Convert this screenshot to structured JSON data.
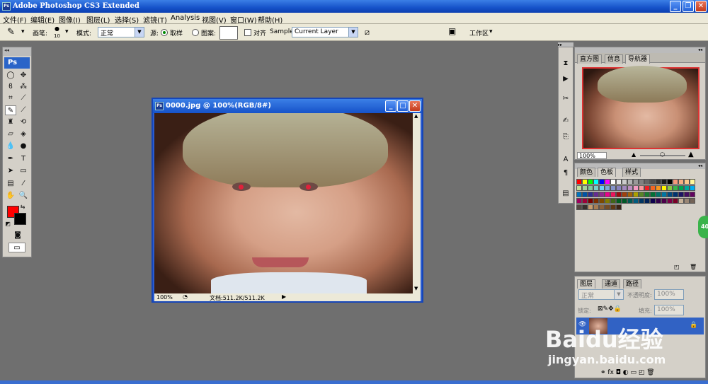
{
  "titlebar": {
    "title": "Adobe Photoshop CS3 Extended"
  },
  "menu": {
    "items": [
      "文件(F)",
      "编辑(E)",
      "图像(I)",
      "图层(L)",
      "选择(S)",
      "滤镜(T)",
      "Analysis",
      "视图(V)",
      "窗口(W)",
      "帮助(H)"
    ]
  },
  "options": {
    "brush_label": "画笔:",
    "brush_size": "10",
    "mode_label": "模式:",
    "mode_value": "正常",
    "source_label": "源:",
    "sampled_label": "取样",
    "pattern_label": "图案:",
    "aligned_label": "对齐",
    "sample_label": "Sample:",
    "sample_value": "Current Layer",
    "workspace_label": "工作区"
  },
  "document": {
    "title": "0000.jpg @ 100%(RGB/8#)",
    "zoom": "100%",
    "doc_info": "文档:511.2K/511.2K"
  },
  "navigator": {
    "tabs": [
      "直方图",
      "信息",
      "导航器"
    ],
    "zoom": "100%"
  },
  "swatches": {
    "tabs": [
      "颜色",
      "色板",
      "样式"
    ]
  },
  "layers": {
    "tabs": [
      "图层",
      "通道",
      "路径"
    ],
    "blend_mode": "正常",
    "opacity_label": "不透明度:",
    "opacity_value": "100%",
    "lock_label": "锁定:",
    "fill_label": "填充:",
    "fill_value": "100%"
  },
  "toolbox": {
    "logo": "Ps"
  },
  "colors": {
    "foreground": "#ff0000",
    "background": "#000000",
    "accent": "#1652c9"
  },
  "watermark": {
    "brand": "Baidu经验",
    "url": "jingyan.baidu.com"
  },
  "side_button": {
    "label": "40"
  }
}
